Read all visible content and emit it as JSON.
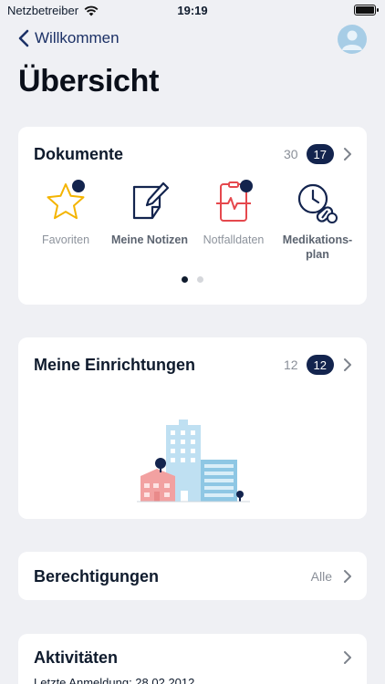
{
  "status_bar": {
    "carrier": "Netzbetreiber",
    "time": "19:19"
  },
  "nav": {
    "back_label": "Willkommen",
    "title": "Übersicht"
  },
  "documents": {
    "title": "Dokumente",
    "total": "30",
    "new_count": "17",
    "items": [
      {
        "label": "Favoriten",
        "icon": "star-icon"
      },
      {
        "label": "Meine Notizen",
        "icon": "notes-icon"
      },
      {
        "label": "Notfalldaten",
        "icon": "emergency-data-icon"
      },
      {
        "label": "Medikations-plan",
        "icon": "medication-plan-icon"
      }
    ],
    "page_count": 2,
    "current_page": 1
  },
  "facilities": {
    "title": "Meine Einrichtungen",
    "total": "12",
    "new_count": "12"
  },
  "permissions": {
    "title": "Berechtigungen",
    "value": "Alle"
  },
  "activities": {
    "title": "Aktivitäten",
    "last_login": "Letzte Anmeldung: 28.02.2012"
  },
  "colors": {
    "primary": "#13244e",
    "star": "#f4b400",
    "emergency": "#e5484d",
    "background": "#eff0f4",
    "building": "#bfe0f2",
    "house": "#f2a1a1"
  }
}
